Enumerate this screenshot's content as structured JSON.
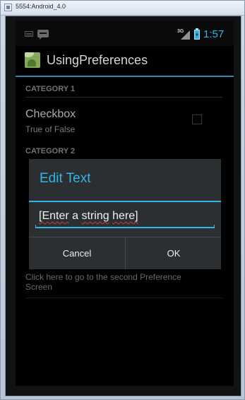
{
  "window": {
    "title": "5554:Android_4.0"
  },
  "status_bar": {
    "network_type": "3G",
    "time": "1:57",
    "icons": [
      "keyboard-icon",
      "message-icon",
      "signal-icon",
      "battery-icon"
    ]
  },
  "action_bar": {
    "title": "UsingPreferences",
    "app_icon": "app-icon"
  },
  "preferences": {
    "category1": "CATEGORY 1",
    "checkbox": {
      "title": "Checkbox",
      "summary": "True of False",
      "checked": false
    },
    "category2": "CATEGORY 2",
    "second_screen_summary": "Click here to go to the second Preference Screen"
  },
  "dialog": {
    "title": "Edit Text",
    "value_words": [
      "[Enter",
      "a",
      "string",
      "here]"
    ],
    "cancel_label": "Cancel",
    "ok_label": "OK"
  },
  "colors": {
    "accent": "#33b5e5",
    "background": "#000000",
    "dialog_background": "#2c2f32",
    "category_text": "#9a9a9a"
  }
}
